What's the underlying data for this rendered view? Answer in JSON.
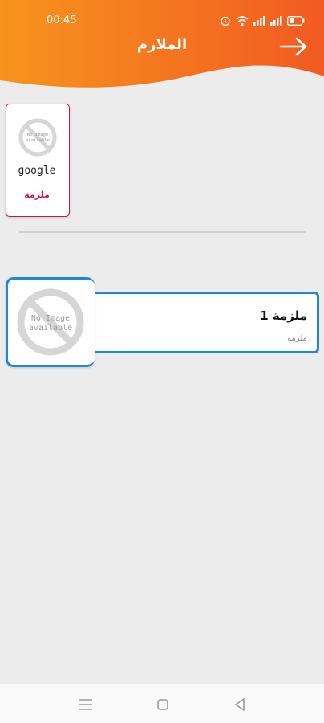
{
  "colors": {
    "header_start": "#f7941d",
    "header_end": "#f25a22",
    "accent_pink": "#c2185b",
    "accent_blue": "#1e88d4"
  },
  "status_bar": {
    "time": "00:45",
    "icons": [
      "alarm-icon",
      "wifi-icon",
      "signal-icon",
      "signal-icon",
      "battery-icon"
    ]
  },
  "header": {
    "title": "الملازم",
    "back_icon": "arrow-right-icon"
  },
  "category": {
    "name": "google",
    "type_label": "ملزمة",
    "image_text": [
      "No Image",
      "available"
    ]
  },
  "files": [
    {
      "title": "ملزمة 1",
      "subtitle": "ملزمة",
      "image_text": [
        "No Image",
        "available"
      ]
    }
  ],
  "nav_bar": {
    "buttons": [
      "menu-icon",
      "home-icon",
      "back-icon"
    ]
  }
}
